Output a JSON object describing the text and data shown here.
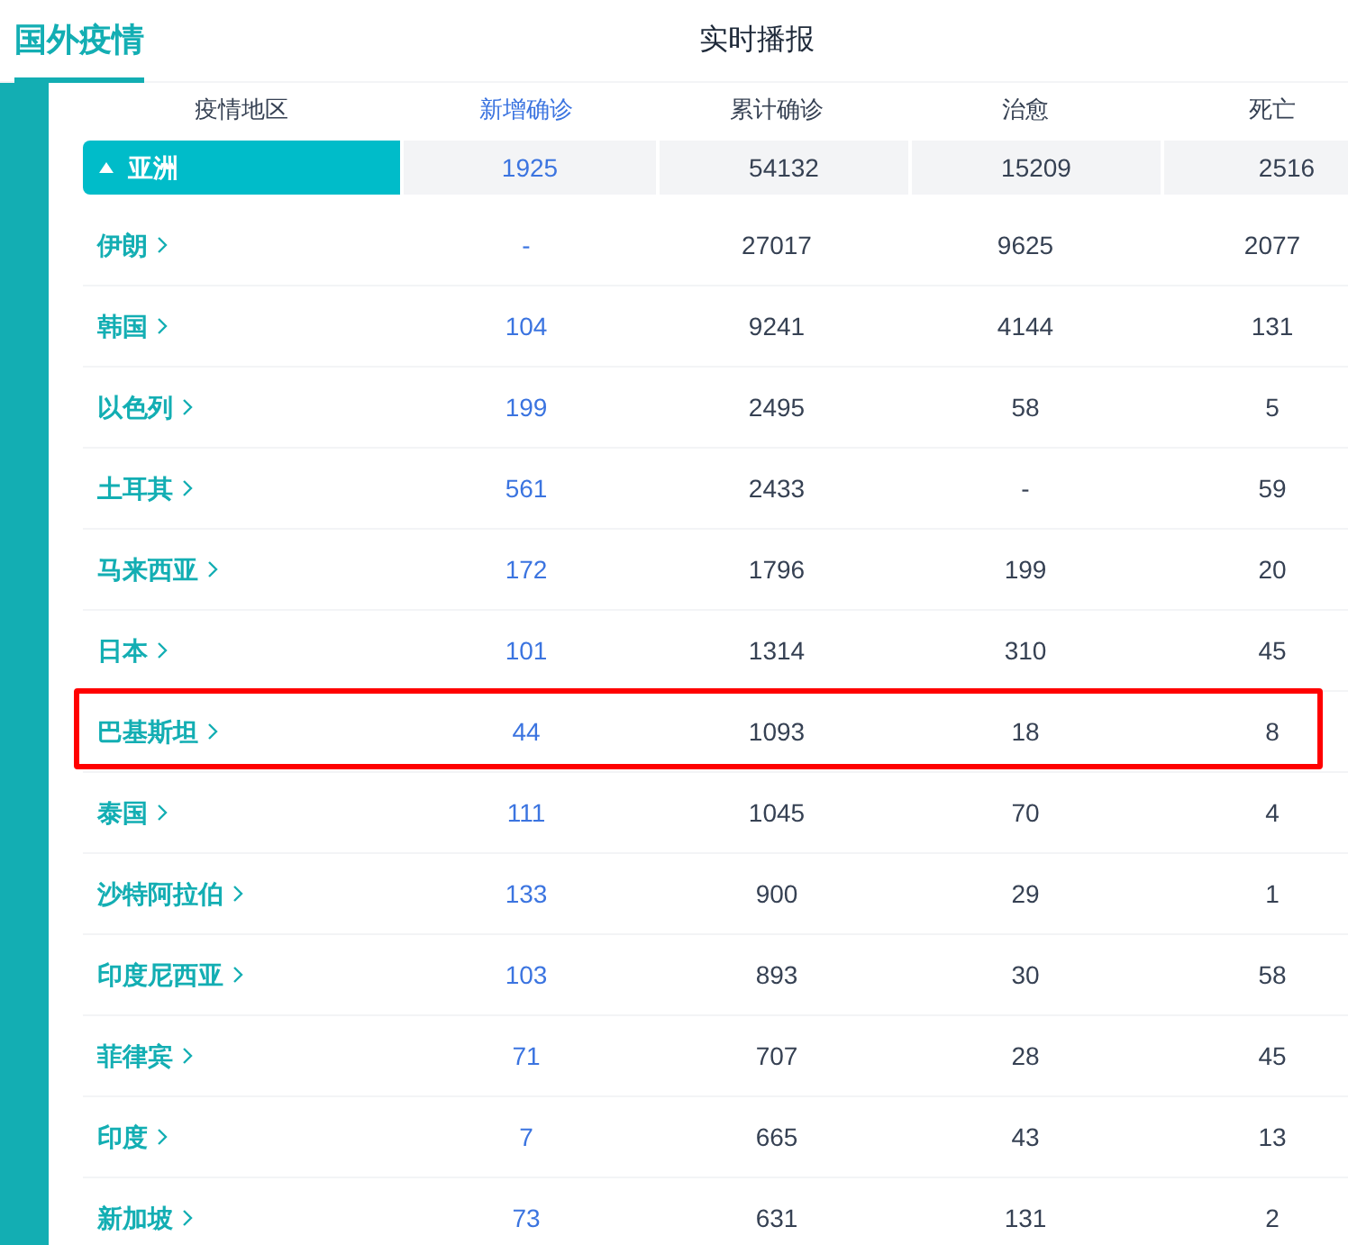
{
  "tabs": [
    {
      "label": "国外疫情",
      "selected": true
    },
    {
      "label": "实时播报",
      "selected": false
    }
  ],
  "table": {
    "columns": [
      "疫情地区",
      "新增确诊",
      "累计确诊",
      "治愈",
      "死亡"
    ],
    "group": {
      "name": "亚洲",
      "expanded": true,
      "new": "1925",
      "total": "54132",
      "cured": "15209",
      "dead": "2516"
    },
    "rows": [
      {
        "name": "伊朗",
        "new": "-",
        "total": "27017",
        "cured": "9625",
        "dead": "2077",
        "highlighted": false
      },
      {
        "name": "韩国",
        "new": "104",
        "total": "9241",
        "cured": "4144",
        "dead": "131",
        "highlighted": false
      },
      {
        "name": "以色列",
        "new": "199",
        "total": "2495",
        "cured": "58",
        "dead": "5",
        "highlighted": false
      },
      {
        "name": "土耳其",
        "new": "561",
        "total": "2433",
        "cured": "-",
        "dead": "59",
        "highlighted": false
      },
      {
        "name": "马来西亚",
        "new": "172",
        "total": "1796",
        "cured": "199",
        "dead": "20",
        "highlighted": false
      },
      {
        "name": "日本",
        "new": "101",
        "total": "1314",
        "cured": "310",
        "dead": "45",
        "highlighted": false
      },
      {
        "name": "巴基斯坦",
        "new": "44",
        "total": "1093",
        "cured": "18",
        "dead": "8",
        "highlighted": true
      },
      {
        "name": "泰国",
        "new": "111",
        "total": "1045",
        "cured": "70",
        "dead": "4",
        "highlighted": false
      },
      {
        "name": "沙特阿拉伯",
        "new": "133",
        "total": "900",
        "cured": "29",
        "dead": "1",
        "highlighted": false
      },
      {
        "name": "印度尼西亚",
        "new": "103",
        "total": "893",
        "cured": "30",
        "dead": "58",
        "highlighted": false
      },
      {
        "name": "菲律宾",
        "new": "71",
        "total": "707",
        "cured": "28",
        "dead": "45",
        "highlighted": false
      },
      {
        "name": "印度",
        "new": "7",
        "total": "665",
        "cured": "43",
        "dead": "13",
        "highlighted": false
      },
      {
        "name": "新加坡",
        "new": "73",
        "total": "631",
        "cured": "131",
        "dead": "2",
        "highlighted": false
      }
    ]
  }
}
